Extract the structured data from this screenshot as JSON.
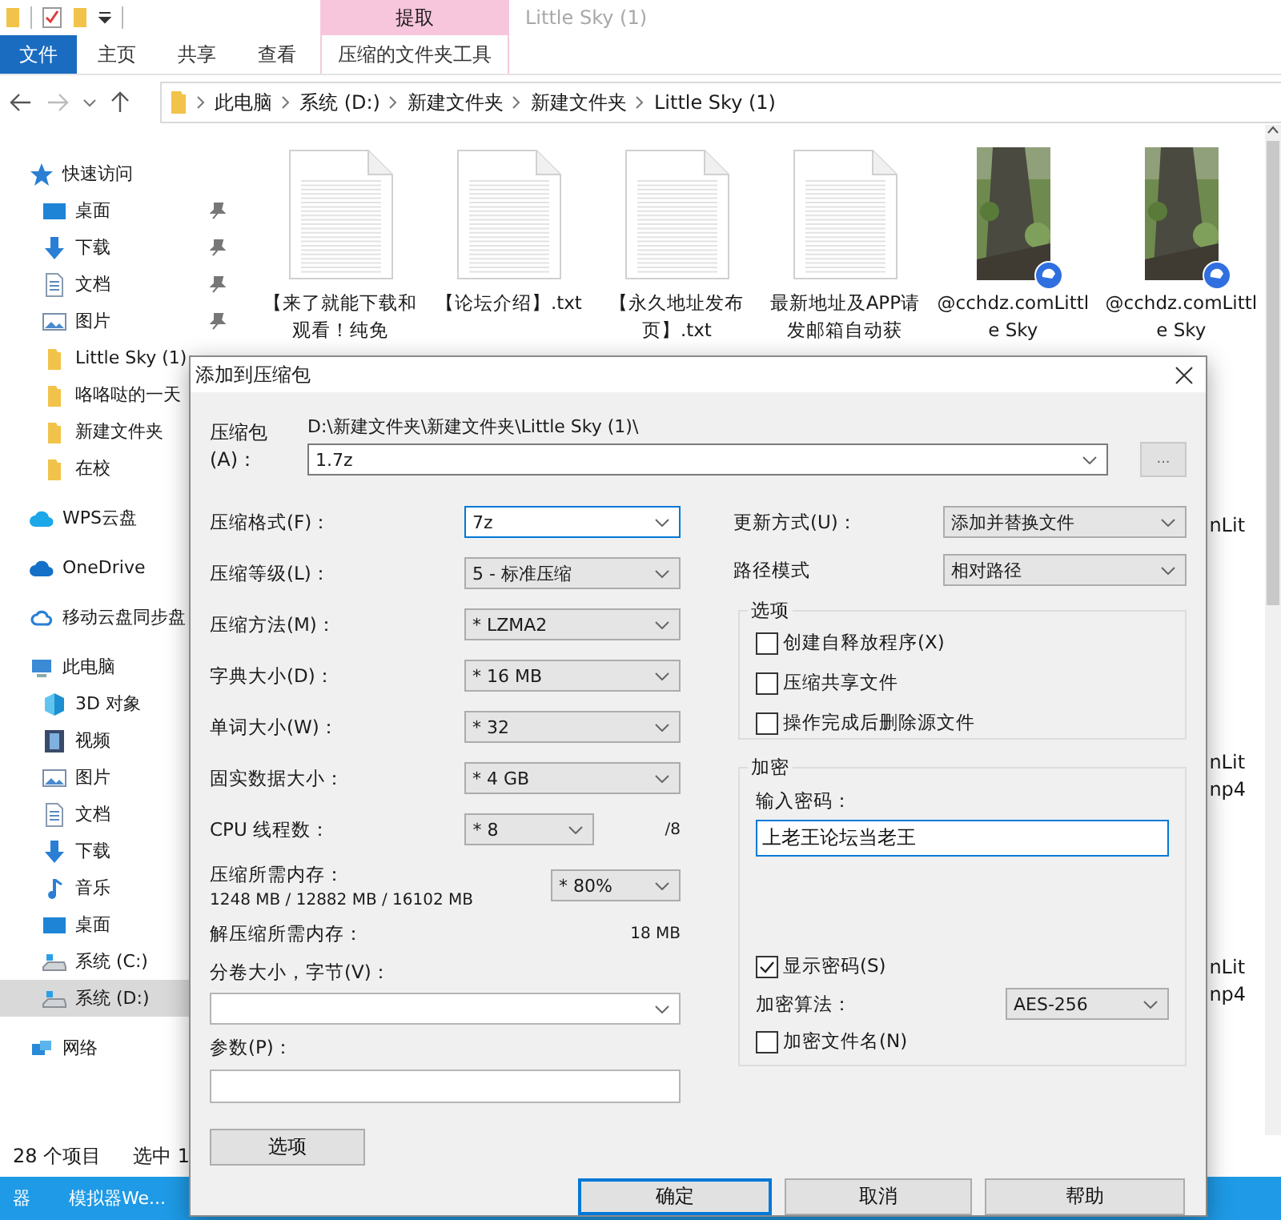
{
  "ribbon": {
    "context_group": "提取",
    "title": "Little Sky (1)",
    "tabs": [
      {
        "label": "文件",
        "kind": "file"
      },
      {
        "label": "主页",
        "kind": "plain"
      },
      {
        "label": "共享",
        "kind": "plain"
      },
      {
        "label": "查看",
        "kind": "plain"
      },
      {
        "label": "压缩的文件夹工具",
        "kind": "context"
      }
    ]
  },
  "address_bar": {
    "crumbs": [
      "此电脑",
      "系统 (D:)",
      "新建文件夹",
      "新建文件夹",
      "Little Sky (1)"
    ]
  },
  "sidebar": {
    "sections": [
      {
        "label": "快速访问",
        "kind": "star",
        "selected": false,
        "children": [
          {
            "label": "桌面",
            "kind": "desktop",
            "pinned": true,
            "selected": false
          },
          {
            "label": "下载",
            "kind": "download",
            "pinned": true,
            "selected": false
          },
          {
            "label": "文档",
            "kind": "document",
            "pinned": true,
            "selected": false
          },
          {
            "label": "图片",
            "kind": "picture",
            "pinned": true,
            "selected": false
          },
          {
            "label": "Little Sky (1)",
            "kind": "folder",
            "pinned": false,
            "selected": false
          },
          {
            "label": "咯咯哒的一天",
            "kind": "folder",
            "pinned": false,
            "selected": false
          },
          {
            "label": "新建文件夹",
            "kind": "folder",
            "pinned": false,
            "selected": false
          },
          {
            "label": "在校",
            "kind": "folder",
            "pinned": false,
            "selected": false
          }
        ]
      },
      {
        "label": "WPS云盘",
        "kind": "cloud",
        "selected": false
      },
      {
        "label": "OneDrive",
        "kind": "onedrive",
        "selected": false
      },
      {
        "label": "移动云盘同步盘",
        "kind": "sync",
        "selected": false
      },
      {
        "label": "此电脑",
        "kind": "pc",
        "selected": false,
        "children": [
          {
            "label": "3D 对象",
            "kind": "cube",
            "pinned": false,
            "selected": false
          },
          {
            "label": "视频",
            "kind": "video",
            "pinned": false,
            "selected": false
          },
          {
            "label": "图片",
            "kind": "picture",
            "pinned": false,
            "selected": false
          },
          {
            "label": "文档",
            "kind": "document",
            "pinned": false,
            "selected": false
          },
          {
            "label": "下载",
            "kind": "download",
            "pinned": false,
            "selected": false
          },
          {
            "label": "音乐",
            "kind": "music",
            "pinned": false,
            "selected": false
          },
          {
            "label": "桌面",
            "kind": "desktop",
            "pinned": false,
            "selected": false
          },
          {
            "label": "系统 (C:)",
            "kind": "drive",
            "pinned": false,
            "selected": false
          },
          {
            "label": "系统 (D:)",
            "kind": "drive",
            "pinned": false,
            "selected": true
          }
        ]
      },
      {
        "label": "网络",
        "kind": "network",
        "selected": false
      }
    ]
  },
  "files": [
    {
      "name": "【来了就能下载和观看！纯免",
      "kind": "text"
    },
    {
      "name": "【论坛介绍】.txt",
      "kind": "text"
    },
    {
      "name": "【永久地址发布页】.txt",
      "kind": "text"
    },
    {
      "name": "最新地址及APP请发邮箱自动获",
      "kind": "text"
    },
    {
      "name": "@cchdz.comLittle Sky",
      "kind": "video"
    },
    {
      "name": "@cchdz.comLittle Sky",
      "kind": "video"
    }
  ],
  "covered_files": [
    {
      "lines": [
        "nLit"
      ]
    },
    {
      "lines": [
        "nLit",
        "np4"
      ]
    },
    {
      "lines": [
        "nLit",
        "np4"
      ]
    }
  ],
  "status_bar": {
    "count": "28 个项目",
    "selection": "选中 1"
  },
  "taskbar": {
    "items": [
      "器",
      "模拟器We..."
    ]
  },
  "dialog": {
    "title": "添加到压缩包",
    "archive": {
      "label": "压缩包(A)：",
      "folder": "D:\\新建文件夹\\新建文件夹\\Little Sky (1)\\",
      "value": "1.7z",
      "browse": "..."
    },
    "settings": [
      {
        "label": "压缩格式(F)：",
        "value": "7z",
        "focused": true
      },
      {
        "label": "压缩等级(L)：",
        "value": "5 - 标准压缩",
        "focused": false
      },
      {
        "label": "压缩方法(M)：",
        "value": "* LZMA2",
        "focused": false
      },
      {
        "label": "字典大小(D)：",
        "value": "* 16 MB",
        "focused": false
      },
      {
        "label": "单词大小(W)：",
        "value": "* 32",
        "focused": false
      },
      {
        "label": "固实数据大小：",
        "value": "* 4 GB",
        "focused": false
      }
    ],
    "threads": {
      "label": "CPU 线程数：",
      "value": "* 8",
      "max": "/8"
    },
    "memory": {
      "label": "压缩所需内存：",
      "detail": "1248 MB / 12882 MB / 16102 MB",
      "value": "* 80%"
    },
    "decompress_memory": {
      "label": "解压缩所需内存：",
      "value": "18 MB"
    },
    "split": {
      "label": "分卷大小，字节(V)："
    },
    "parameters": {
      "label": "参数(P)："
    },
    "options_button": "选项",
    "update_mode": {
      "label": "更新方式(U)：",
      "value": "添加并替换文件"
    },
    "path_mode": {
      "label": "路径模式",
      "value": "相对路径"
    },
    "options": {
      "title": "选项",
      "checkboxes": [
        {
          "label": "创建自释放程序(X)",
          "checked": false
        },
        {
          "label": "压缩共享文件",
          "checked": false
        },
        {
          "label": "操作完成后删除源文件",
          "checked": false
        }
      ]
    },
    "encryption": {
      "title": "加密",
      "password_label": "输入密码：",
      "password": "上老王论坛当老王",
      "show_password": {
        "label": "显示密码(S)",
        "checked": true
      },
      "method": {
        "label": "加密算法：",
        "value": "AES-256"
      },
      "encrypt_names": {
        "label": "加密文件名(N)",
        "checked": false
      }
    },
    "buttons": [
      {
        "label": "确定",
        "default": true
      },
      {
        "label": "取消",
        "default": false
      },
      {
        "label": "帮助",
        "default": false
      }
    ]
  }
}
